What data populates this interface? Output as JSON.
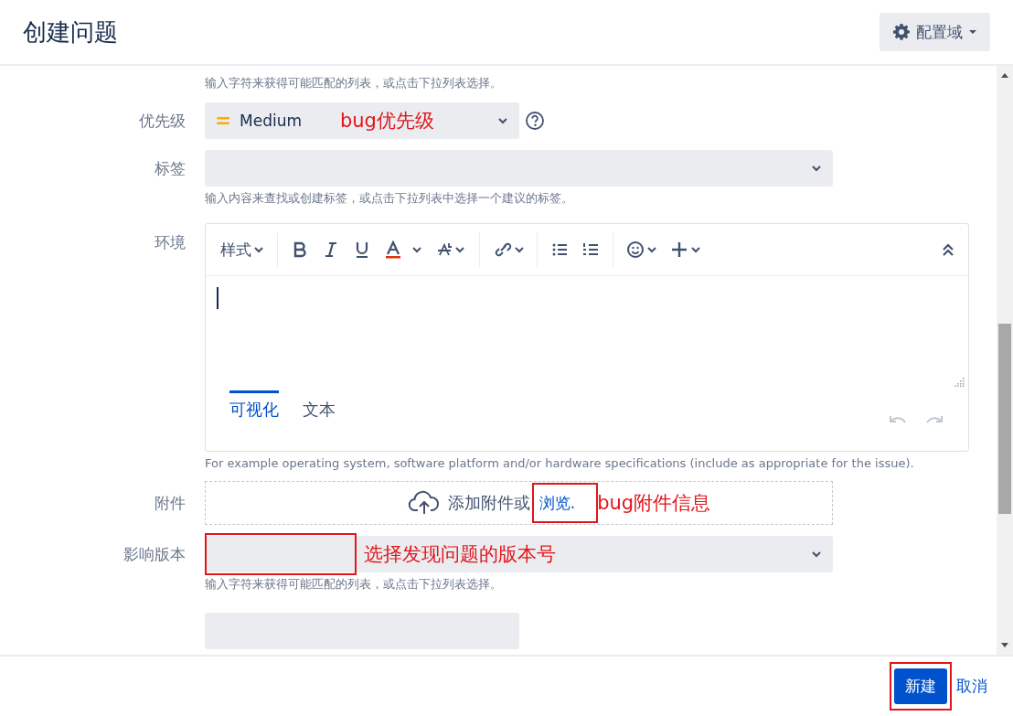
{
  "header": {
    "title": "创建问题",
    "config_button": "配置域"
  },
  "form": {
    "top_hint": "输入字符来获得可能匹配的列表，或点击下拉列表选择。",
    "fields": [
      {
        "kind": "select",
        "label": "优先级",
        "value": "Medium",
        "help": true,
        "annotation": "bug优先级"
      },
      {
        "kind": "select",
        "label": "标签",
        "hint": "输入内容来查找或创建标签，或点击下拉列表中选择一个建议的标签。"
      },
      {
        "kind": "editor",
        "label": "环境",
        "style_menu": "样式",
        "tabs": [
          {
            "label": "可视化",
            "selected": true
          },
          {
            "label": "文本",
            "selected": false
          }
        ],
        "hint": "For example operating system, software platform and/or hardware specifications (include as appropriate for the issue)."
      },
      {
        "kind": "attachment",
        "label": "附件",
        "prompt": "添加附件或",
        "link": "浏览.",
        "boxed": true,
        "annotation": "bug附件信息"
      },
      {
        "kind": "select",
        "label": "影响版本",
        "boxed": true,
        "annotation": "选择发现问题的版本号",
        "hint": "输入字符来获得可能匹配的列表，或点击下拉列表选择。"
      },
      {
        "kind": "partial"
      }
    ]
  },
  "footer": {
    "create_button": "新建",
    "create_boxed": true,
    "cancel_link": "取消"
  }
}
